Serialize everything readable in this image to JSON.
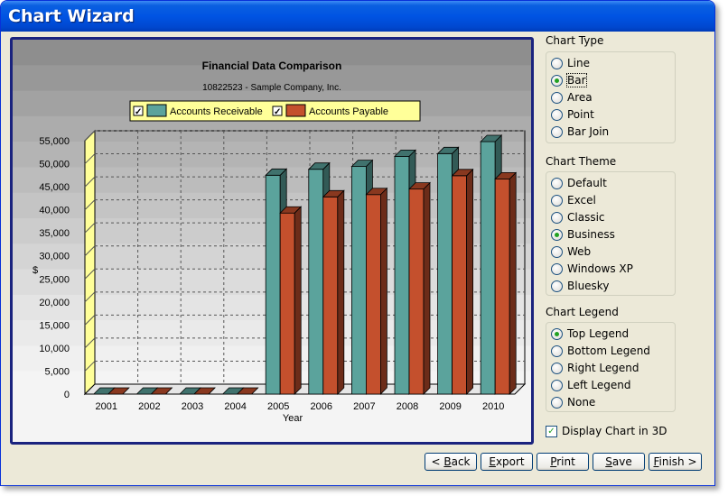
{
  "window": {
    "title": "Chart Wizard"
  },
  "chart_data": {
    "type": "bar",
    "title": "Financial Data Comparison",
    "subtitle": "10822523 - Sample Company, Inc.",
    "xlabel": "Year",
    "ylabel": "$",
    "categories": [
      "2001",
      "2002",
      "2003",
      "2004",
      "2005",
      "2006",
      "2007",
      "2008",
      "2009",
      "2010"
    ],
    "series": [
      {
        "name": "Accounts Receivable",
        "color": "#5ba39c",
        "values": [
          0,
          0,
          0,
          0,
          47500,
          48800,
          49400,
          51600,
          52200,
          54800
        ]
      },
      {
        "name": "Accounts Payable",
        "color": "#c4502d",
        "values": [
          0,
          0,
          0,
          0,
          39300,
          42800,
          43300,
          44500,
          47400,
          46700
        ]
      }
    ],
    "yticks": [
      "0",
      "5,000",
      "10,000",
      "15,000",
      "20,000",
      "25,000",
      "30,000",
      "35,000",
      "40,000",
      "45,000",
      "50,000",
      "55,000"
    ],
    "ylim": [
      0,
      55000
    ],
    "grid": true,
    "legend_position": "top",
    "three_d": true
  },
  "chart_type": {
    "label": "Chart Type",
    "options": [
      "Line",
      "Bar",
      "Area",
      "Point",
      "Bar Join"
    ],
    "selected": "Bar"
  },
  "chart_theme": {
    "label": "Chart Theme",
    "options": [
      "Default",
      "Excel",
      "Classic",
      "Business",
      "Web",
      "Windows XP",
      "Bluesky"
    ],
    "selected": "Business"
  },
  "chart_legend": {
    "label": "Chart Legend",
    "options": [
      "Top Legend",
      "Bottom Legend",
      "Right Legend",
      "Left Legend",
      "None"
    ],
    "selected": "Top Legend"
  },
  "display3d": {
    "label": "Display Chart in 3D",
    "checked": true
  },
  "buttons": [
    {
      "name": "back-button",
      "prefix": "< ",
      "underline": "B",
      "rest": "ack"
    },
    {
      "name": "export-button",
      "prefix": "",
      "underline": "E",
      "rest": "xport"
    },
    {
      "name": "print-button",
      "prefix": "",
      "underline": "P",
      "rest": "rint"
    },
    {
      "name": "save-button",
      "prefix": "",
      "underline": "S",
      "rest": "ave"
    },
    {
      "name": "finish-button",
      "prefix": "",
      "underline": "F",
      "rest": "inish >"
    }
  ]
}
